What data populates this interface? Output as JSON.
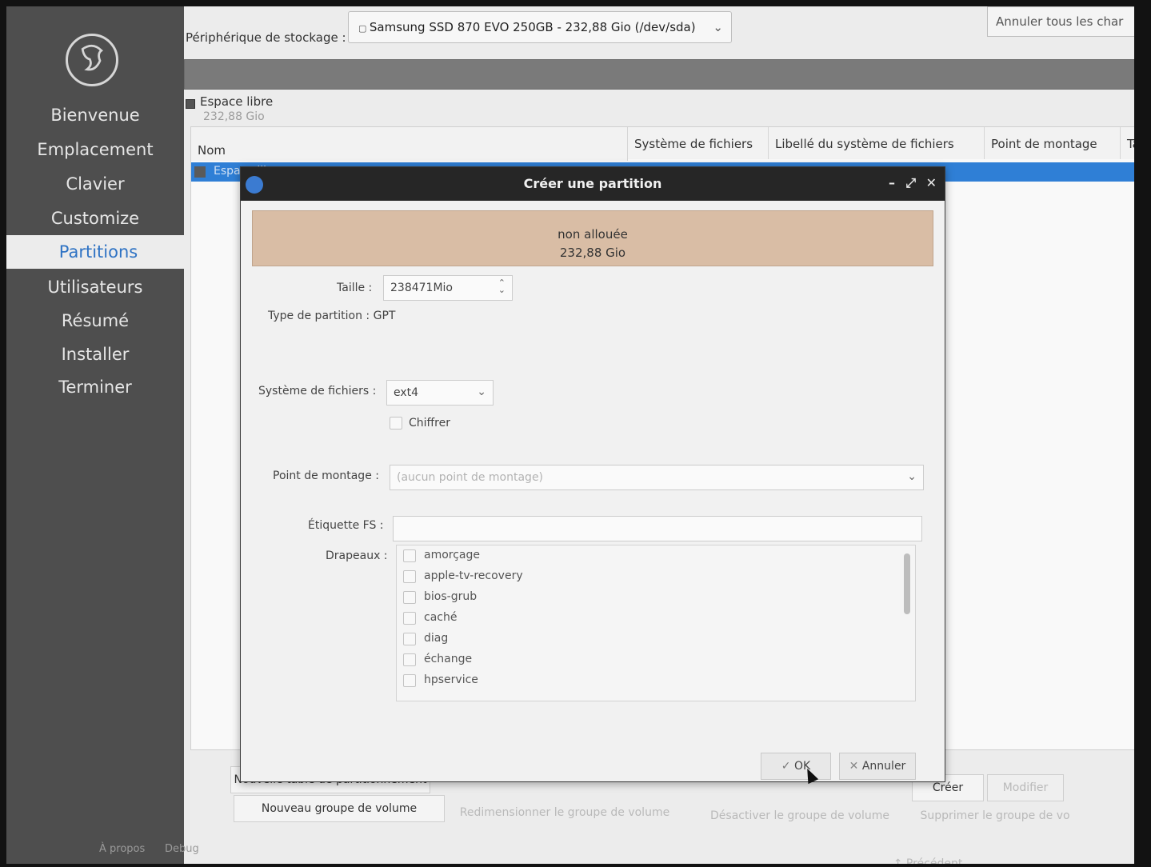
{
  "sidebar": {
    "items": [
      {
        "label": "Bienvenue",
        "active": false
      },
      {
        "label": "Emplacement",
        "active": false
      },
      {
        "label": "Clavier",
        "active": false
      },
      {
        "label": "Customize",
        "active": false
      },
      {
        "label": "Partitions",
        "active": true
      },
      {
        "label": "Utilisateurs",
        "active": false
      },
      {
        "label": "Résumé",
        "active": false
      },
      {
        "label": "Installer",
        "active": false
      },
      {
        "label": "Terminer",
        "active": false
      }
    ],
    "footer": {
      "about": "À propos",
      "debug": "Debug"
    }
  },
  "header": {
    "device_label": "Périphérique de stockage :",
    "device_value": "Samsung SSD 870 EVO 250GB - 232,88 Gio (/dev/sda)",
    "revert_button": "Annuler tous les char"
  },
  "legend": {
    "name": "Espace libre",
    "size": "232,88 Gio"
  },
  "table": {
    "columns": [
      "Nom",
      "Système de fichiers",
      "Libellé du système de fichiers",
      "Point de montage",
      "Ta"
    ],
    "selected_row": "Espace libre"
  },
  "buttons": {
    "new_table": "Nouvelle table de partitionnement",
    "create": "Créer",
    "edit": "Modifier",
    "new_vg": "Nouveau groupe de volume",
    "resize_vg": "Redimensionner le groupe de volume",
    "deactivate_vg": "Désactiver le groupe de volume",
    "remove_vg": "Supprimer le groupe de vo",
    "back": "Précédent"
  },
  "dialog": {
    "title": "Créer une partition",
    "unallocated_label": "non allouée",
    "unallocated_size": "232,88 Gio",
    "size_label": "Taille :",
    "size_value": "238471Mio",
    "partition_type": "Type de partition : GPT",
    "fs_label": "Système de fichiers :",
    "fs_value": "ext4",
    "encrypt_label": "Chiffrer",
    "mount_label": "Point de montage :",
    "mount_value": "(aucun point de montage)",
    "fs_tag_label": "Étiquette FS :",
    "fs_tag_value": "",
    "flags_label": "Drapeaux :",
    "flags": [
      "amorçage",
      "apple-tv-recovery",
      "bios-grub",
      "caché",
      "diag",
      "échange",
      "hpservice"
    ],
    "ok_button": "OK",
    "cancel_button": "Annuler"
  }
}
